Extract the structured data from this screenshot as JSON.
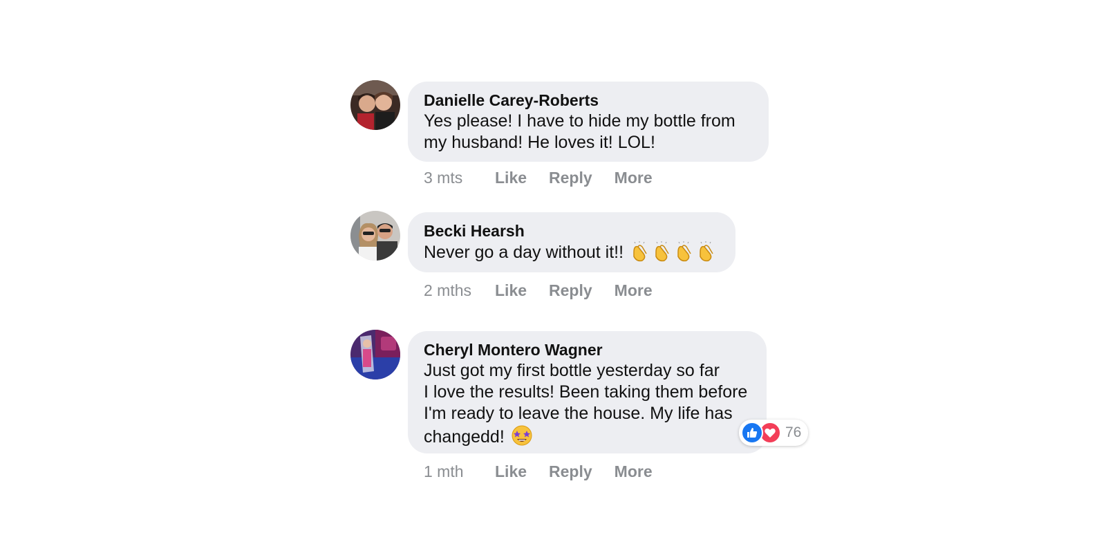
{
  "comments": [
    {
      "author": "Danielle Carey-Roberts",
      "lines": [
        "Yes please! I have to hide my bottle from",
        "my husband! He loves it! LOL!"
      ],
      "time": "3 mts",
      "actions": [
        "Like",
        "Reply",
        "More"
      ]
    },
    {
      "author": "Becki Hearsh",
      "lines": [
        "Never go a day without it!!"
      ],
      "emojis": [
        "clapping-hands-icon",
        "clapping-hands-icon",
        "clapping-hands-icon",
        "clapping-hands-icon"
      ],
      "time": "2 mths",
      "actions": [
        "Like",
        "Reply",
        "More"
      ]
    },
    {
      "author": "Cheryl Montero Wagner",
      "lines": [
        "Just got my first bottle yesterday so far",
        "I love the results! Been taking them before",
        "I'm ready to leave the house. My life has",
        "changedd!"
      ],
      "emojis": [
        "star-struck-icon"
      ],
      "time": "1 mth",
      "actions": [
        "Like",
        "Reply",
        "More"
      ],
      "reactions": {
        "icons": [
          "like-icon",
          "love-icon"
        ],
        "count": "76"
      }
    }
  ],
  "colors": {
    "bubble": "#edeef2",
    "meta_text": "#8a8d91",
    "like_blue": "#1877f2",
    "love_red": "#f33e58"
  }
}
